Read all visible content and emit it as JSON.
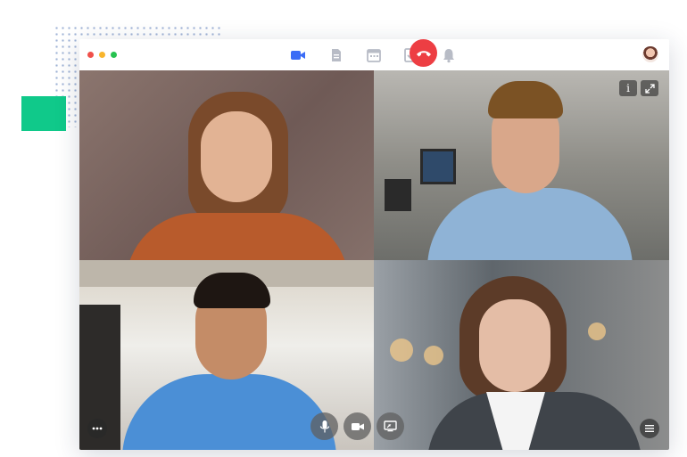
{
  "decor": {
    "dots_color": "#8ea6cf",
    "square_color": "#10c98a"
  },
  "window": {
    "traffic_lights": [
      "#f0504a",
      "#f8b52d",
      "#27c250"
    ],
    "toolbar": {
      "icons": [
        "video-camera-icon",
        "document-icon",
        "calendar-icon",
        "task-check-icon",
        "bell-icon"
      ],
      "active_icon": "video-camera-icon",
      "active_color": "#3b6cf6",
      "inactive_color": "#b8bcc6"
    },
    "user_avatar": "user-avatar"
  },
  "call": {
    "participants": [
      {
        "position": "top-left"
      },
      {
        "position": "top-right"
      },
      {
        "position": "bottom-left"
      },
      {
        "position": "bottom-right"
      }
    ],
    "overlay": {
      "info_label": "i",
      "expand_icon": "expand-icon"
    },
    "controls": {
      "more_icon": "more-icon",
      "mic_icon": "microphone-icon",
      "camera_icon": "camera-icon",
      "share_icon": "screen-share-icon",
      "end_icon": "end-call-icon",
      "end_color": "#ed3e43",
      "menu_icon": "menu-icon"
    }
  }
}
